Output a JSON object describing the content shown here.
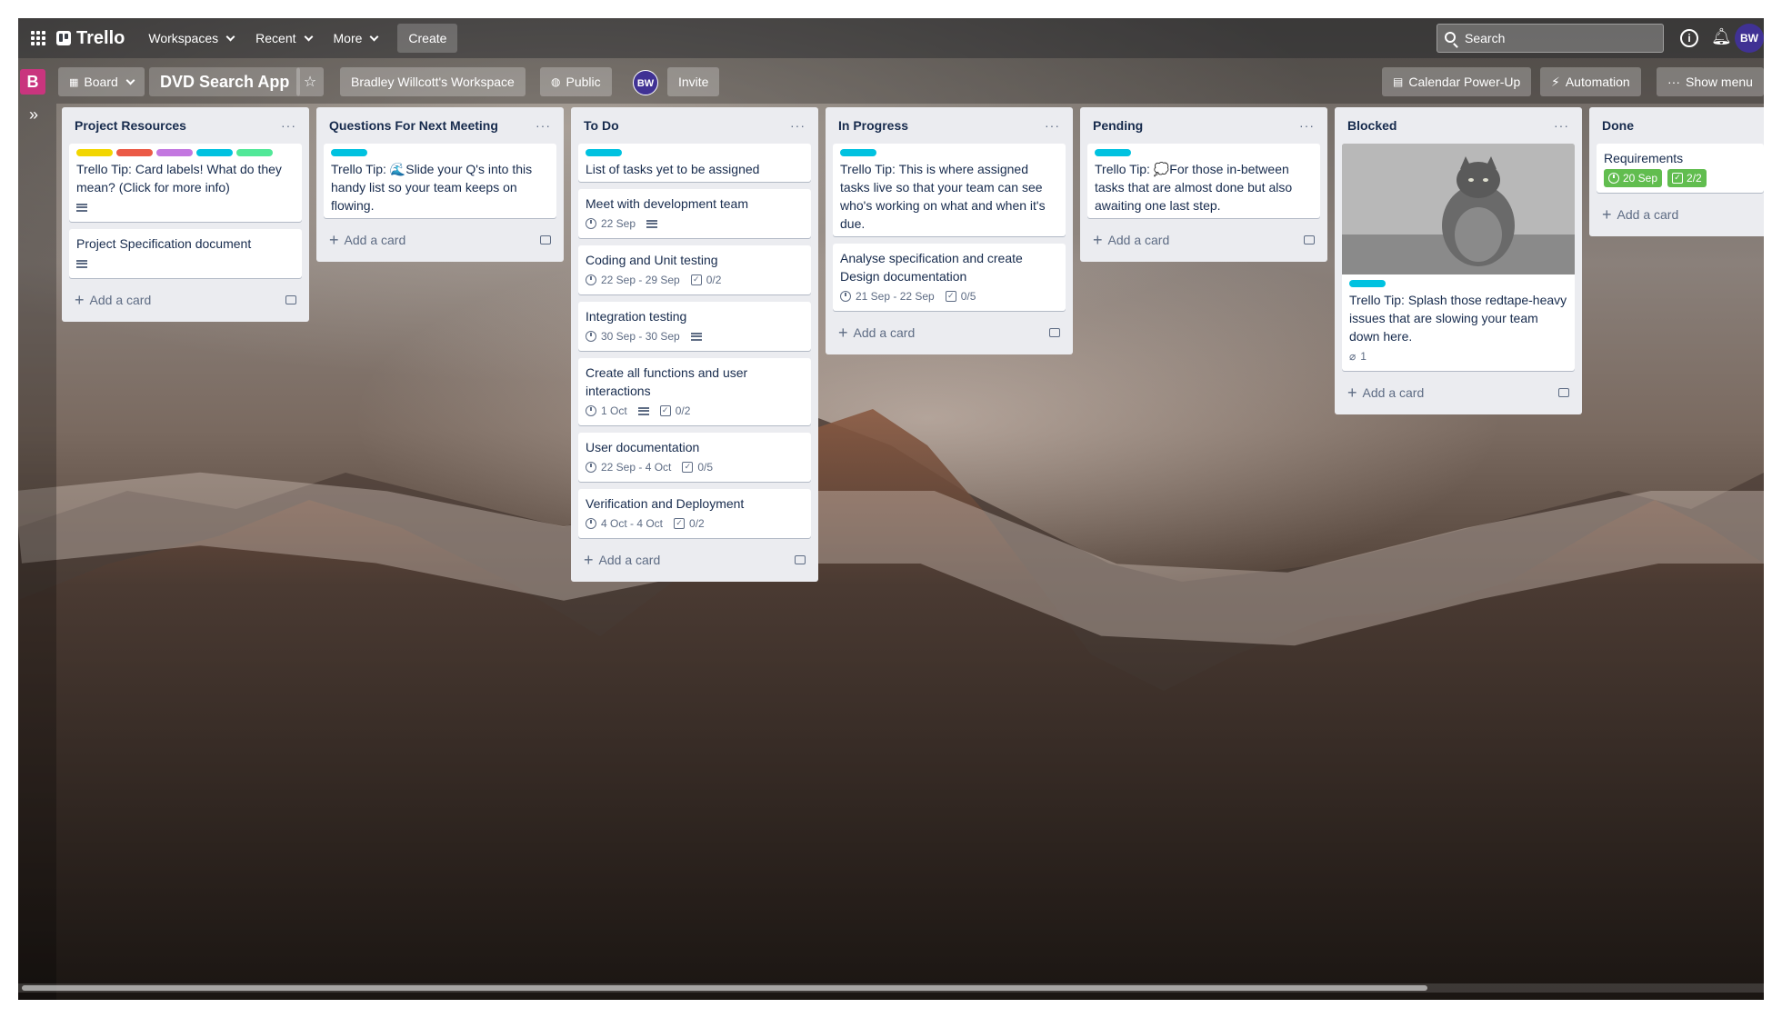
{
  "app": {
    "name": "Trello"
  },
  "topnav": {
    "workspaces": "Workspaces",
    "recent": "Recent",
    "more": "More",
    "create": "Create",
    "search_placeholder": "Search",
    "avatar": "BW"
  },
  "board": {
    "badge": "B",
    "view": "Board",
    "title": "DVD Search App",
    "workspace": "Bradley Willcott's Workspace",
    "visibility": "Public",
    "member_initials": "BW",
    "invite": "Invite",
    "calendar": "Calendar Power-Up",
    "automation": "Automation",
    "show_menu": "Show menu"
  },
  "add_card": "Add a card",
  "lists": [
    {
      "title": "Project Resources",
      "cards": [
        {
          "text": "Trello Tip: Card labels! What do they mean? (Click for more info)",
          "labels": [
            "#f2d600",
            "#eb5a46",
            "#c377e0",
            "#00c2e0",
            "#51e898"
          ]
        },
        {
          "text": "Project Specification document"
        }
      ]
    },
    {
      "title": "Questions For Next Meeting",
      "cards": [
        {
          "text": "Trello Tip: 🌊Slide your Q's into this handy list so your team keeps on flowing.",
          "labels": [
            "#00c2e0"
          ]
        }
      ]
    },
    {
      "title": "To Do",
      "cards": [
        {
          "text": "List of tasks yet to be assigned",
          "labels": [
            "#00c2e0"
          ]
        },
        {
          "text": "Meet with development team",
          "date": "22 Sep"
        },
        {
          "text": "Coding and Unit testing",
          "date": "22 Sep - 29 Sep",
          "checklist": "0/2"
        },
        {
          "text": "Integration testing",
          "date": "30 Sep - 30 Sep"
        },
        {
          "text": "Create all functions and user interactions",
          "date": "1 Oct",
          "checklist": "0/2"
        },
        {
          "text": "User documentation",
          "date": "22 Sep - 4 Oct",
          "checklist": "0/5"
        },
        {
          "text": "Verification and Deployment",
          "date": "4 Oct - 4 Oct",
          "checklist": "0/2"
        }
      ]
    },
    {
      "title": "In Progress",
      "cards": [
        {
          "text": "Trello Tip: This is where assigned tasks live so that your team can see who's working on what and when it's due.",
          "labels": [
            "#00c2e0"
          ]
        },
        {
          "text": "Analyse specification and create Design documentation",
          "date": "21 Sep - 22 Sep",
          "checklist": "0/5"
        }
      ]
    },
    {
      "title": "Pending",
      "cards": [
        {
          "text": "Trello Tip: 💭For those in-between tasks that are almost done but also awaiting one last step.",
          "labels": [
            "#00c2e0"
          ]
        }
      ]
    },
    {
      "title": "Blocked",
      "cards": [
        {
          "text": "Trello Tip: Splash those redtape-heavy issues that are slowing your team down here.",
          "labels": [
            "#00c2e0"
          ],
          "attachments": "1"
        }
      ]
    },
    {
      "title": "Done",
      "cards": [
        {
          "text": "Requirements",
          "date": "20 Sep",
          "checklist": "2/2"
        }
      ]
    }
  ],
  "menu_dots": "···"
}
